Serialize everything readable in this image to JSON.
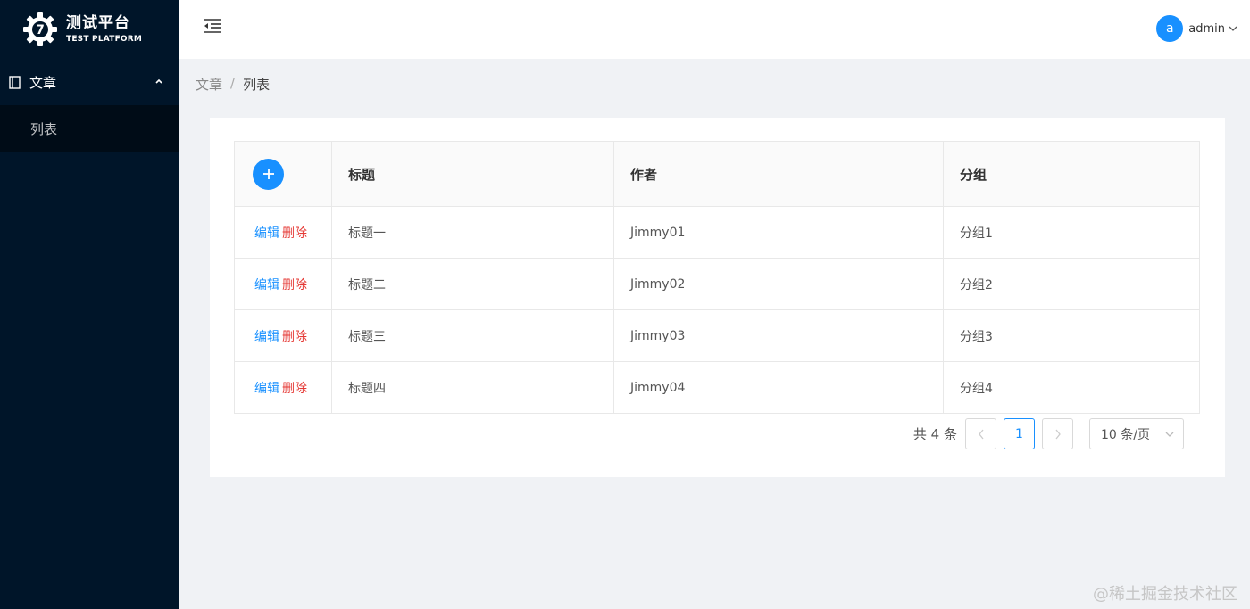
{
  "app": {
    "title": "测试平台",
    "subtitle": "TEST PLATFORM",
    "logo_letter": "7"
  },
  "sidebar": {
    "group": {
      "label": "文章",
      "icon": "book-icon",
      "expanded": true
    },
    "items": [
      {
        "label": "列表",
        "active": true
      }
    ]
  },
  "header": {
    "fold_icon": "menu-fold-icon",
    "user": {
      "avatar_letter": "a",
      "name": "admin"
    }
  },
  "breadcrumb": {
    "parent": "文章",
    "separator": "/",
    "current": "列表"
  },
  "table": {
    "headers": {
      "title": "标题",
      "author": "作者",
      "group": "分组"
    },
    "add_icon": "plus-icon",
    "edit_label": "编辑",
    "delete_label": "删除",
    "rows": [
      {
        "title": "标题一",
        "author": "Jimmy01",
        "group": "分组1"
      },
      {
        "title": "标题二",
        "author": "Jimmy02",
        "group": "分组2"
      },
      {
        "title": "标题三",
        "author": "Jimmy03",
        "group": "分组3"
      },
      {
        "title": "标题四",
        "author": "Jimmy04",
        "group": "分组4"
      }
    ]
  },
  "pagination": {
    "total_text": "共 4 条",
    "current_page": "1",
    "page_size": "10 条/页"
  },
  "watermark": "@稀土掘金技术社区",
  "colors": {
    "sidebar": "#001529",
    "primary": "#1890ff",
    "danger": "#e53935"
  }
}
